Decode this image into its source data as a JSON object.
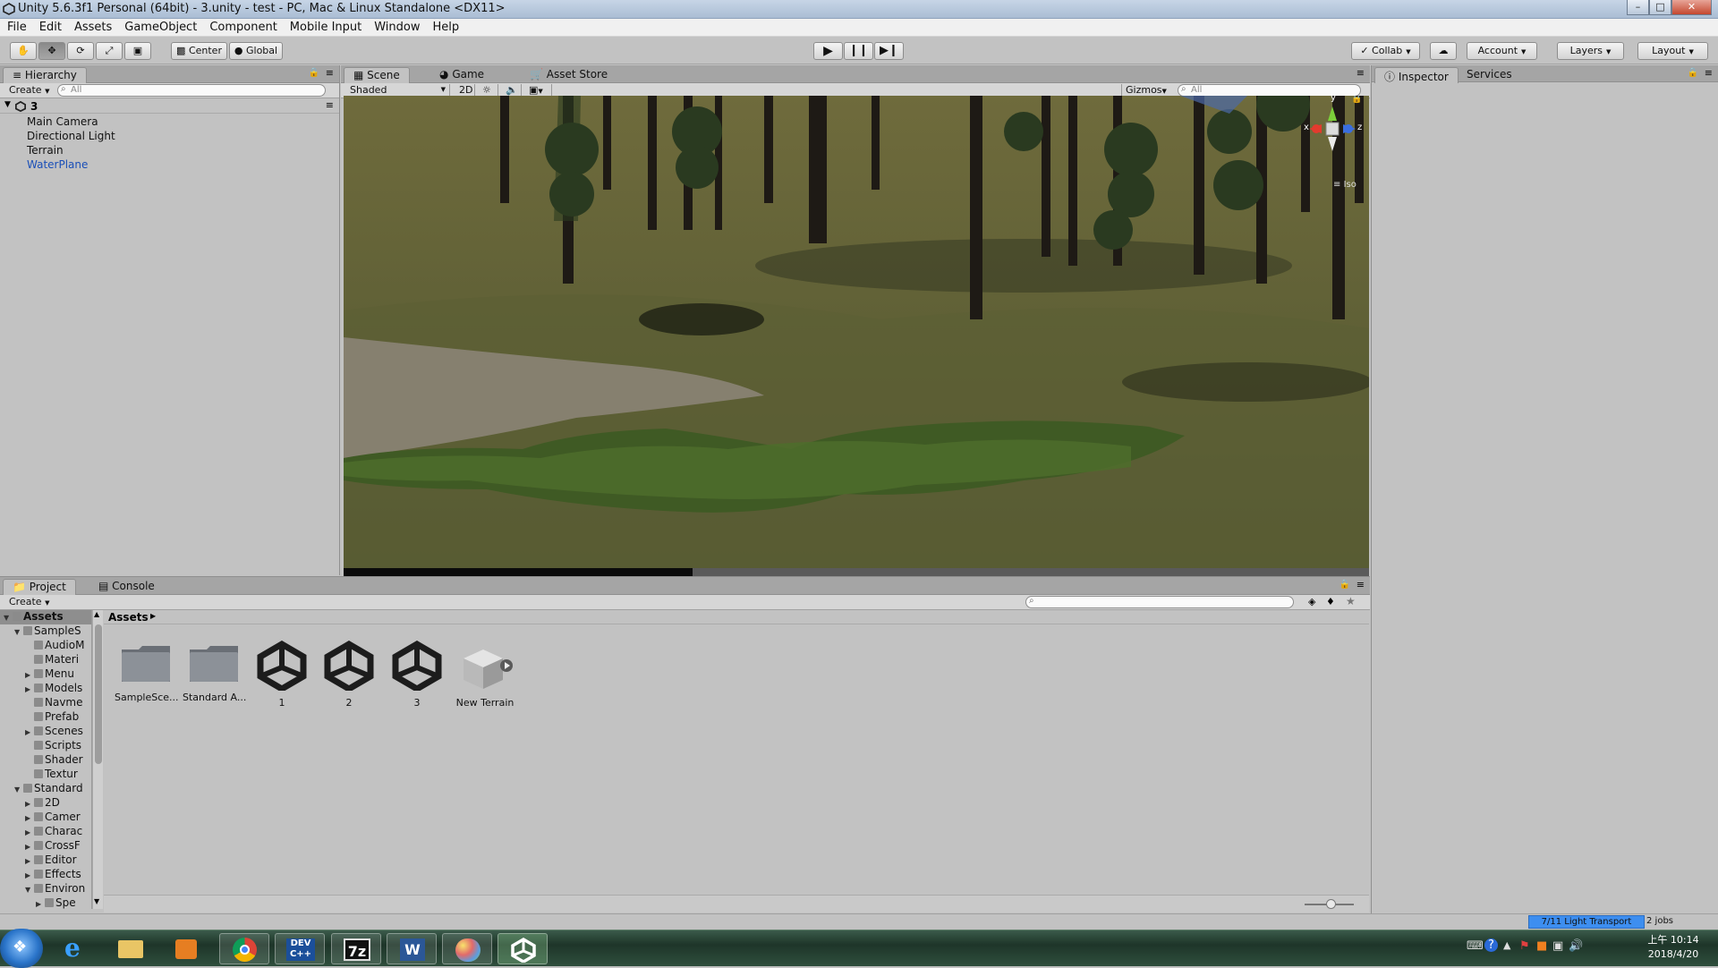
{
  "window": {
    "title": "Unity 5.6.3f1 Personal (64bit) - 3.unity - test - PC, Mac & Linux Standalone <DX11>"
  },
  "menu": [
    "File",
    "Edit",
    "Assets",
    "GameObject",
    "Component",
    "Mobile Input",
    "Window",
    "Help"
  ],
  "toolbar": {
    "pivot_label": "Center",
    "space_label": "Global",
    "collab_label": "Collab",
    "account_label": "Account",
    "layers_label": "Layers",
    "layout_label": "Layout"
  },
  "hierarchy": {
    "tab": "Hierarchy",
    "create": "Create",
    "search_placeholder": "All",
    "scene_name": "3",
    "items": [
      "Main Camera",
      "Directional Light",
      "Terrain",
      "WaterPlane"
    ]
  },
  "scene_tabs": {
    "scene": "Scene",
    "game": "Game",
    "asset_store": "Asset Store"
  },
  "scene_bar": {
    "shading": "Shaded",
    "mode_2d": "2D",
    "gizmos": "Gizmos",
    "search_placeholder": "All",
    "projection": "Iso"
  },
  "gizmo_axes": {
    "y": "y",
    "x": "x",
    "z": "z"
  },
  "inspector": {
    "tab": "Inspector",
    "services_tab": "Services"
  },
  "project": {
    "tab": "Project",
    "console_tab": "Console",
    "create": "Create",
    "breadcrumb": "Assets",
    "tree": [
      {
        "label": "Assets",
        "level": 0,
        "expanded": true,
        "root": true
      },
      {
        "label": "SampleS",
        "level": 1,
        "expanded": true
      },
      {
        "label": "AudioM",
        "level": 2
      },
      {
        "label": "Materi",
        "level": 2
      },
      {
        "label": "Menu",
        "level": 2,
        "collapsed": true
      },
      {
        "label": "Models",
        "level": 2,
        "collapsed": true
      },
      {
        "label": "Navme",
        "level": 2
      },
      {
        "label": "Prefab",
        "level": 2
      },
      {
        "label": "Scenes",
        "level": 2,
        "collapsed": true
      },
      {
        "label": "Scripts",
        "level": 2
      },
      {
        "label": "Shader",
        "level": 2
      },
      {
        "label": "Textur",
        "level": 2
      },
      {
        "label": "Standard",
        "level": 1,
        "expanded": true
      },
      {
        "label": "2D",
        "level": 2,
        "collapsed": true
      },
      {
        "label": "Camer",
        "level": 2,
        "collapsed": true
      },
      {
        "label": "Charac",
        "level": 2,
        "collapsed": true
      },
      {
        "label": "CrossF",
        "level": 2,
        "collapsed": true
      },
      {
        "label": "Editor",
        "level": 2,
        "collapsed": true
      },
      {
        "label": "Effects",
        "level": 2,
        "collapsed": true
      },
      {
        "label": "Environ",
        "level": 2,
        "expanded": true
      },
      {
        "label": "Spe",
        "level": 3,
        "collapsed": true
      }
    ],
    "assets": [
      {
        "label": "SampleSce...",
        "type": "folder"
      },
      {
        "label": "Standard A...",
        "type": "folder"
      },
      {
        "label": "1",
        "type": "scene"
      },
      {
        "label": "2",
        "type": "scene"
      },
      {
        "label": "3",
        "type": "scene"
      },
      {
        "label": "New Terrain",
        "type": "terrain"
      }
    ]
  },
  "status": {
    "light_transport": "7/11 Light Transport",
    "jobs": "2 jobs"
  },
  "taskbar": {
    "apps": [
      "start",
      "internet-explorer",
      "file-explorer",
      "media-player",
      "chrome",
      "dev-cpp",
      "7zip",
      "word",
      "paint",
      "unity"
    ],
    "time": "上午 10:14",
    "date": "2018/4/20"
  },
  "colors": {
    "selected_item": "#1a4fb8",
    "panel_bg": "#c2c2c2",
    "status_highlight": "#3d8ef0"
  }
}
